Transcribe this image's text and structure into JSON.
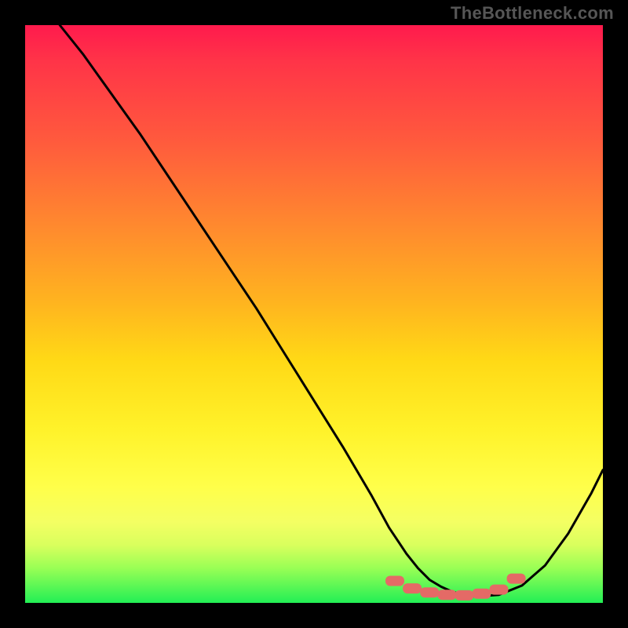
{
  "attribution": "TheBottleneck.com",
  "chart_data": {
    "type": "line",
    "title": "",
    "xlabel": "",
    "ylabel": "",
    "xlim": [
      0,
      100
    ],
    "ylim": [
      0,
      100
    ],
    "grid": false,
    "legend": false,
    "background": "rainbow-vertical-gradient",
    "series": [
      {
        "name": "bottleneck-curve",
        "color": "#000000",
        "x": [
          6,
          10,
          15,
          20,
          25,
          30,
          35,
          40,
          45,
          50,
          55,
          60,
          63,
          66,
          68,
          70,
          72,
          74,
          76,
          78,
          82,
          86,
          90,
          94,
          98,
          100
        ],
        "y": [
          100,
          95,
          88,
          81,
          73.5,
          66,
          58.5,
          51,
          43,
          35,
          27,
          18.5,
          13,
          8.5,
          6,
          4,
          2.8,
          1.9,
          1.3,
          1.1,
          1.4,
          3,
          6.5,
          12,
          19,
          23
        ]
      }
    ],
    "markers": [
      {
        "name": "optimal-range-dots",
        "shape": "rounded-rect",
        "color": "#e46a66",
        "points": [
          {
            "x": 64,
            "y": 3.8
          },
          {
            "x": 67,
            "y": 2.5
          },
          {
            "x": 70,
            "y": 1.8
          },
          {
            "x": 73,
            "y": 1.4
          },
          {
            "x": 76,
            "y": 1.3
          },
          {
            "x": 79,
            "y": 1.6
          },
          {
            "x": 82,
            "y": 2.3
          },
          {
            "x": 85,
            "y": 4.2
          }
        ]
      }
    ]
  }
}
